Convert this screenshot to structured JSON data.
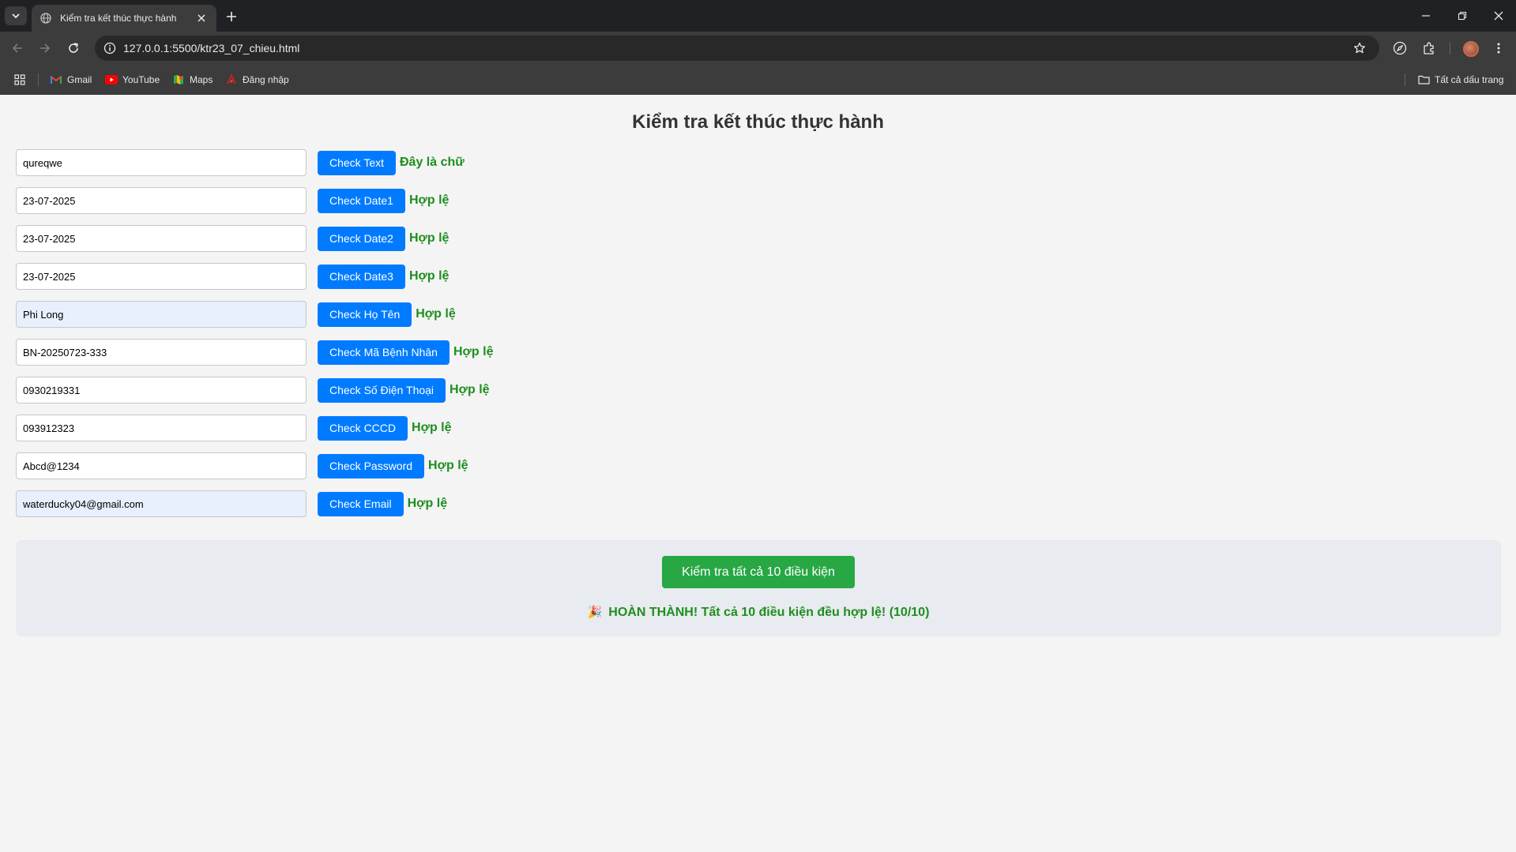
{
  "browser": {
    "tab_title": "Kiểm tra kết thúc thực hành",
    "url": "127.0.0.1:5500/ktr23_07_chieu.html",
    "bookmarks": [
      {
        "label": "Gmail",
        "icon": "gmail-icon"
      },
      {
        "label": "YouTube",
        "icon": "youtube-icon"
      },
      {
        "label": "Maps",
        "icon": "maps-icon"
      },
      {
        "label": "Đăng nhập",
        "icon": "login-icon"
      }
    ],
    "all_bookmarks_label": "Tất cả dấu trang"
  },
  "page": {
    "title": "Kiểm tra kết thúc thực hành",
    "rows": [
      {
        "value": "qureqwe",
        "button": "Check Text",
        "result": "Đây là chữ"
      },
      {
        "value": "23-07-2025",
        "button": "Check Date1",
        "result": "Hợp lệ"
      },
      {
        "value": "23-07-2025",
        "button": "Check Date2",
        "result": "Hợp lệ"
      },
      {
        "value": "23-07-2025",
        "button": "Check Date3",
        "result": "Hợp lệ"
      },
      {
        "value": "Phi Long",
        "button": "Check Họ Tên",
        "result": "Hợp lệ"
      },
      {
        "value": "BN-20250723-333",
        "button": "Check Mã Bệnh Nhân",
        "result": "Hợp lệ"
      },
      {
        "value": "0930219331",
        "button": "Check Số Điện Thoại",
        "result": "Hợp lệ"
      },
      {
        "value": "093912323",
        "button": "Check CCCD",
        "result": "Hợp lệ"
      },
      {
        "value": "Abcd@1234",
        "button": "Check Password",
        "result": "Hợp lệ"
      },
      {
        "value": "waterducky04@gmail.com",
        "button": "Check Email",
        "result": "Hợp lệ"
      }
    ],
    "check_all_button": "Kiểm tra tất cả 10 điều kiện",
    "summary_message": "HOÀN THÀNH! Tất cả 10 điều kiện đều hợp lệ! (10/10)",
    "summary_emoji": "🎉"
  },
  "colors": {
    "button_blue": "#007bff",
    "button_green": "#28a745",
    "valid_green": "#1e8e1e"
  }
}
